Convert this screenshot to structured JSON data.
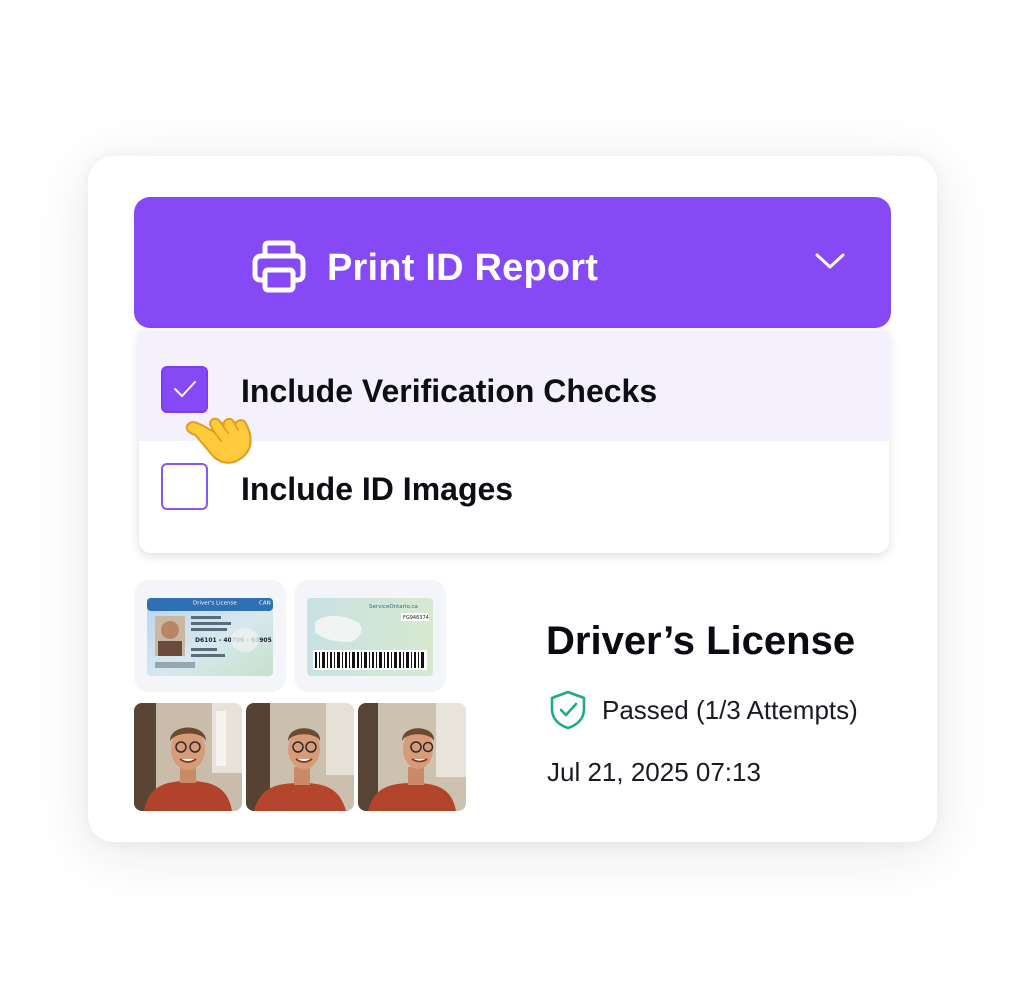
{
  "print_button": {
    "label": "Print ID Report",
    "icon": "printer-icon",
    "expand_icon": "chevron-down-icon",
    "color": "#8549f6"
  },
  "options": [
    {
      "label": "Include Verification Checks",
      "checked": true
    },
    {
      "label": "Include ID Images",
      "checked": false
    }
  ],
  "document": {
    "title": "Driver’s License",
    "status": "Passed (1/3 Attempts)",
    "status_icon": "shield-check-icon",
    "status_color": "#1bab86",
    "timestamp": "Jul 21, 2025 07:13",
    "card_header": "Driver's License",
    "card_country": "CAN",
    "card_number": "D6101 - 40706 - 60905",
    "card_back_number": "FG946374",
    "card_back_site": "ServiceOntario.ca"
  }
}
